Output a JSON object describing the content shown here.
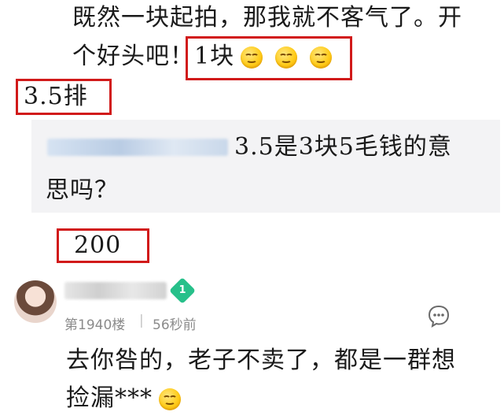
{
  "top_comment": {
    "line1": "既然一块起拍，那我就不客气了。开",
    "line2_text": "个好头吧！",
    "line2_highlight": "1块",
    "emoji_count": 3
  },
  "annotation_bid_1": "3.5排",
  "quoted_reply": {
    "line1": "3.5是3块5毛钱的意",
    "line2": "思吗？"
  },
  "annotation_bid_2": "200",
  "comment": {
    "floor": "第1940楼",
    "separator": "|",
    "time": "56秒前",
    "vip_level": "1",
    "line1": "去你咎的，老子不卖了，都是一群想",
    "line2": "捡漏***"
  },
  "icons": {
    "emoji": "smile-emoji-icon",
    "vip": "vip-diamond-icon",
    "reply": "reply-bubble-icon"
  },
  "colors": {
    "highlight_box": "#d11a1a",
    "vip_badge": "#27c08a",
    "quote_bg": "#f3f3f5"
  }
}
